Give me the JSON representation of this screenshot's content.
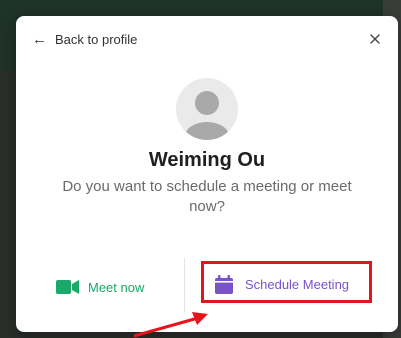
{
  "dialog": {
    "back_label": "Back to profile",
    "close_icon": "close-icon",
    "avatar_icon": "person-icon",
    "name": "Weiming Ou",
    "question": "Do you want to schedule a meeting or meet now?"
  },
  "actions": {
    "meet_now_label": "Meet now",
    "meet_now_icon": "video-camera-icon",
    "schedule_label": "Schedule Meeting",
    "schedule_icon": "calendar-icon"
  },
  "colors": {
    "meet_now": "#1aa86b",
    "schedule": "#7a52c7",
    "annotation": "#e8141c"
  }
}
